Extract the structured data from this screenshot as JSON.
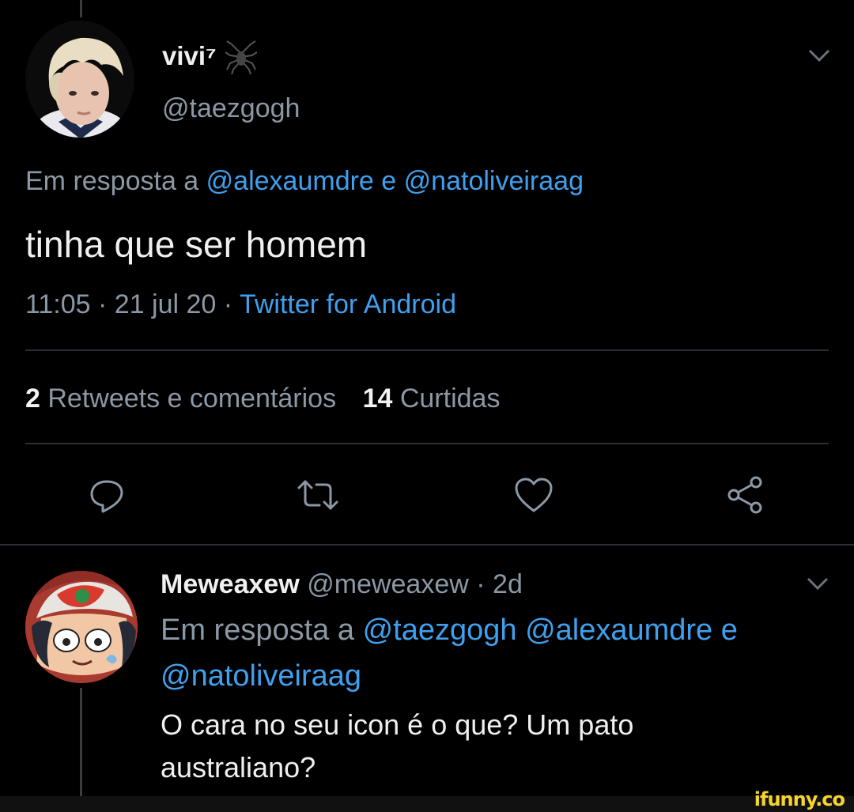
{
  "tweet": {
    "display_name": "vivi⁷",
    "handle": "@taezgogh",
    "reply_prefix": "Em resposta a",
    "reply_mentions": [
      "@alexaumdre",
      "@natoliveiraag"
    ],
    "reply_joiner": "e",
    "text": "tinha que ser homem",
    "time": "11:05",
    "date": "21 jul 20",
    "separator": "·",
    "source": "Twitter for Android",
    "retweets_count": "2",
    "retweets_label": "Retweets e comentários",
    "likes_count": "14",
    "likes_label": "Curtidas"
  },
  "reply": {
    "display_name": "Meweaxew",
    "handle": "@meweaxew",
    "separator": "·",
    "age": "2d",
    "reply_prefix": "Em resposta a",
    "reply_mentions": [
      "@taezgogh",
      "@alexaumdre",
      "@natoliveiraag"
    ],
    "reply_joiner": "e",
    "text_line1": "O cara no seu icon é o que? Um pato",
    "text_line2": "australiano?"
  },
  "watermark": "ifunny.co",
  "icons": {
    "spider": "spider-icon",
    "chevron": "chevron-down-icon",
    "reply": "reply-icon",
    "retweet": "retweet-icon",
    "like": "heart-icon",
    "share": "share-icon"
  },
  "colors": {
    "background": "#000000",
    "link": "#3fa0ef",
    "muted": "#8b98a5",
    "text": "#f0f0f0",
    "watermark": "#f7d52b"
  }
}
